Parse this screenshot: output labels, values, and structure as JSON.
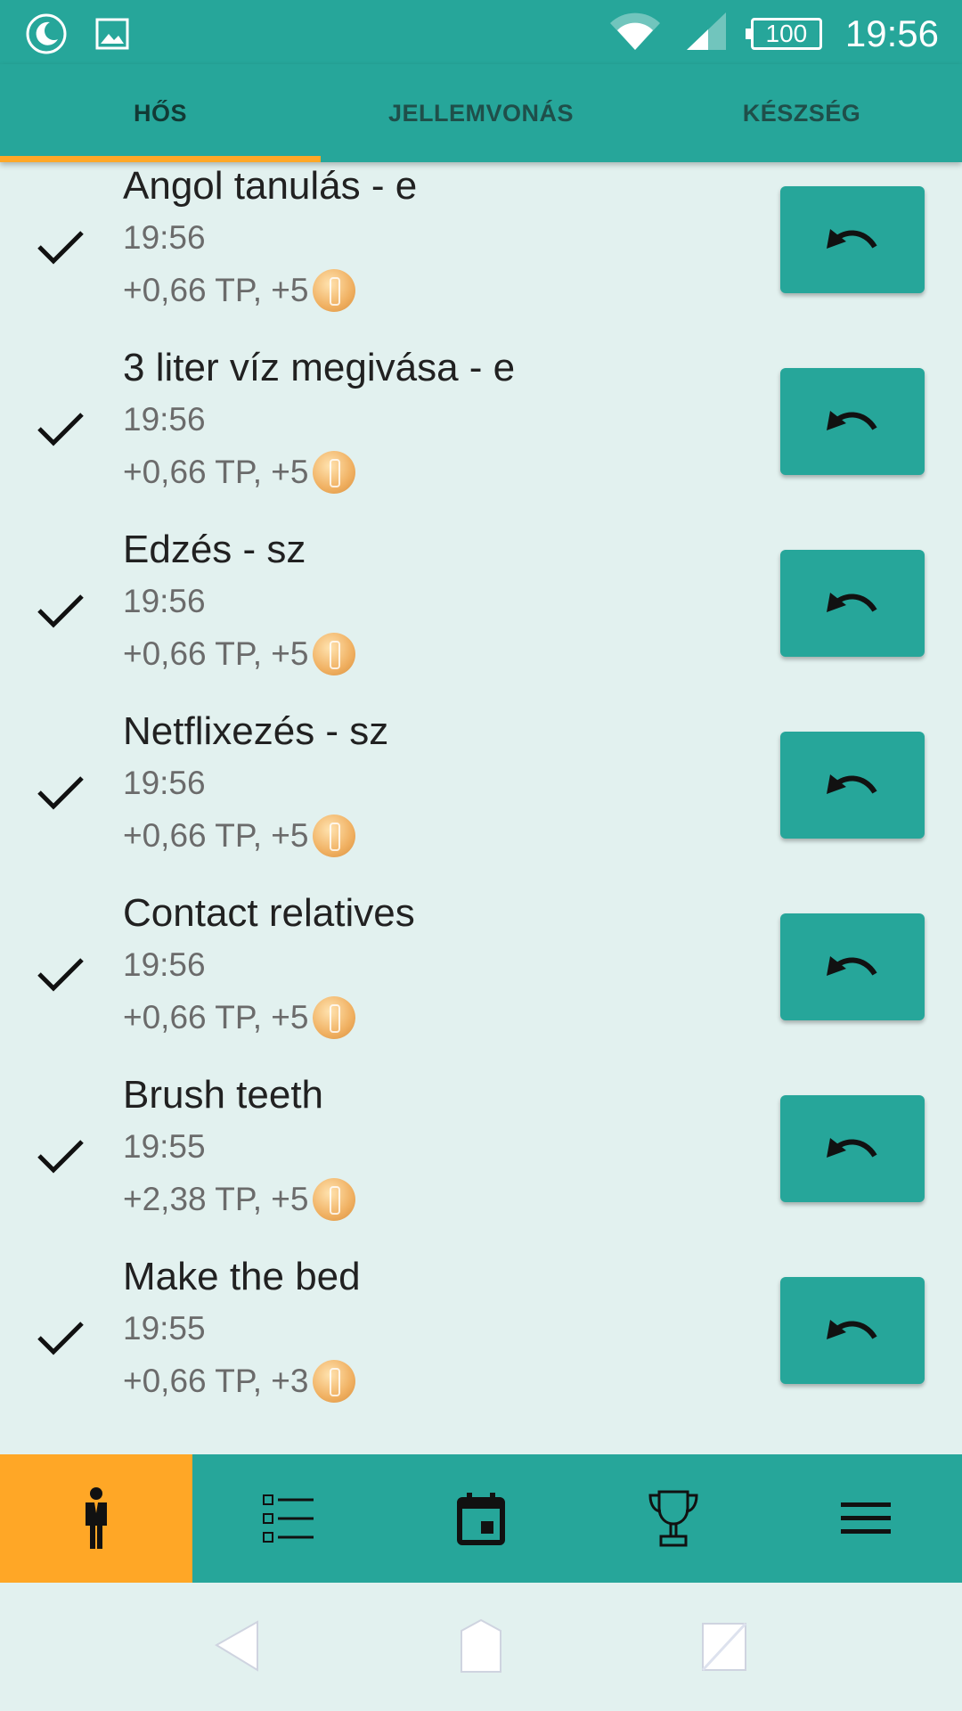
{
  "status_bar": {
    "time": "19:56",
    "battery": "100",
    "left_icons": [
      "moon-icon",
      "image-icon"
    ],
    "right_icons": [
      "wifi-icon",
      "signal-icon",
      "battery-icon"
    ]
  },
  "tabs": [
    {
      "label": "HŐS",
      "active": true
    },
    {
      "label": "JELLEMVONÁS",
      "active": false
    },
    {
      "label": "KÉSZSÉG",
      "active": false
    }
  ],
  "items": [
    {
      "title": "Angol tanulás - e",
      "time": "19:56",
      "reward": "+0,66 TP, +5"
    },
    {
      "title": "3 liter víz megivása - e",
      "time": "19:56",
      "reward": "+0,66 TP, +5"
    },
    {
      "title": "Edzés - sz",
      "time": "19:56",
      "reward": "+0,66 TP, +5"
    },
    {
      "title": "Netflixezés - sz",
      "time": "19:56",
      "reward": "+0,66 TP, +5"
    },
    {
      "title": "Contact relatives",
      "time": "19:56",
      "reward": "+0,66 TP, +5"
    },
    {
      "title": "Brush teeth",
      "time": "19:55",
      "reward": "+2,38 TP, +5"
    },
    {
      "title": "Make the bed",
      "time": "19:55",
      "reward": "+0,66 TP, +3"
    }
  ],
  "bottom_nav": [
    {
      "icon": "hero-icon",
      "active": true
    },
    {
      "icon": "checklist-icon",
      "active": false
    },
    {
      "icon": "calendar-icon",
      "active": false
    },
    {
      "icon": "trophy-icon",
      "active": false
    },
    {
      "icon": "menu-icon",
      "active": false
    }
  ],
  "colors": {
    "primary": "#26a69a",
    "accent": "#ffa726",
    "background": "#e2f1ef"
  }
}
